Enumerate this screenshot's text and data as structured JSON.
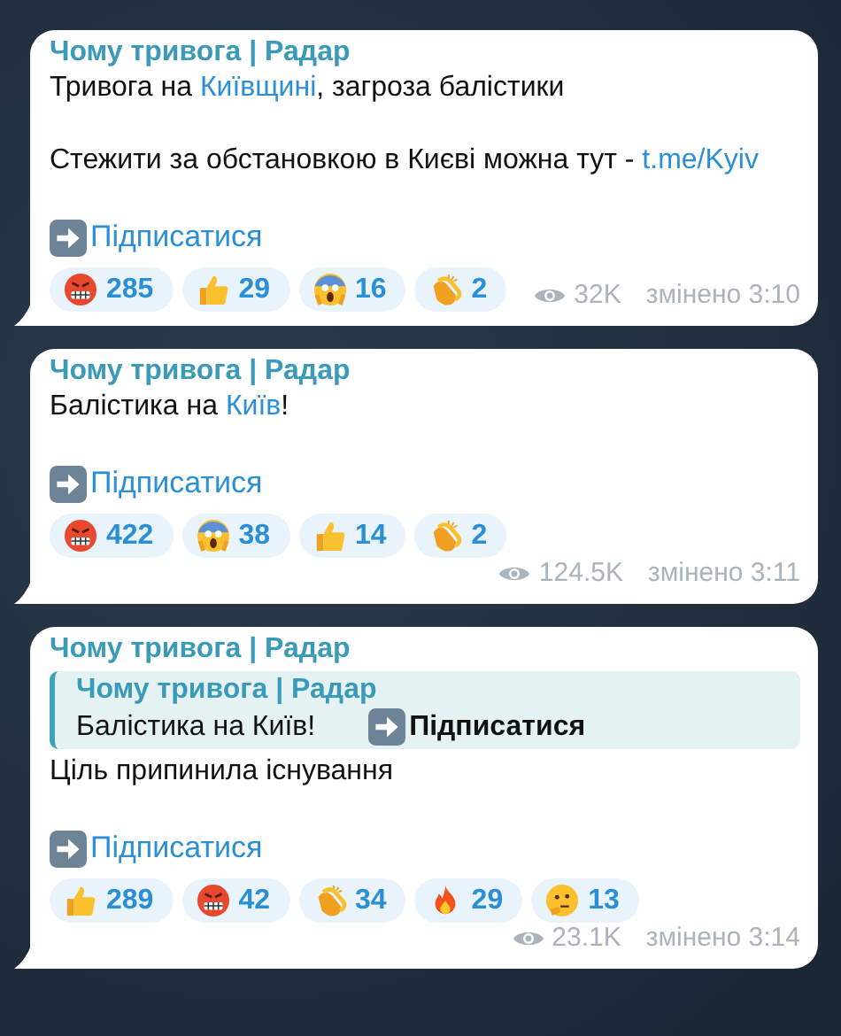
{
  "messages": [
    {
      "channel": "Чому тривога | Радар",
      "paragraphs": [
        [
          {
            "text": "Тривога на "
          },
          {
            "text": "Київщині",
            "link": true
          },
          {
            "text": ", загроза балістики"
          }
        ],
        [
          {
            "text": "Стежити за обстановкою в Києві можна тут - "
          },
          {
            "text": "t.me/Kyiv",
            "link": true
          }
        ]
      ],
      "subscribe": "Підписатися",
      "reactions": [
        {
          "kind": "angry",
          "count": "285"
        },
        {
          "kind": "thumbs",
          "count": "29"
        },
        {
          "kind": "scream",
          "count": "16"
        },
        {
          "kind": "clap",
          "count": "2"
        }
      ],
      "views": "32K",
      "edited": "змінено 3:10"
    },
    {
      "channel": "Чому тривога | Радар",
      "paragraphs": [
        [
          {
            "text": "Балістика на "
          },
          {
            "text": "Київ",
            "link": true
          },
          {
            "text": "!"
          }
        ]
      ],
      "subscribe": "Підписатися",
      "reactions": [
        {
          "kind": "angry",
          "count": "422"
        },
        {
          "kind": "scream",
          "count": "38"
        },
        {
          "kind": "thumbs",
          "count": "14"
        },
        {
          "kind": "clap",
          "count": "2"
        }
      ],
      "views": "124.5K",
      "edited": "змінено 3:11"
    },
    {
      "channel": "Чому тривога | Радар",
      "reply": {
        "channel": "Чому тривога | Радар",
        "text": "Балістика на Київ!",
        "subscribe": "Підписатися"
      },
      "paragraphs": [
        [
          {
            "text": "Ціль припинила існування",
            "link": false
          }
        ]
      ],
      "subscribe": "Підписатися",
      "reactions": [
        {
          "kind": "thumbs",
          "count": "289"
        },
        {
          "kind": "angry",
          "count": "42"
        },
        {
          "kind": "clap",
          "count": "34"
        },
        {
          "kind": "fire",
          "count": "29"
        },
        {
          "kind": "thinking",
          "count": "13"
        }
      ],
      "views": "23.1K",
      "edited": "змінено 3:14"
    }
  ]
}
